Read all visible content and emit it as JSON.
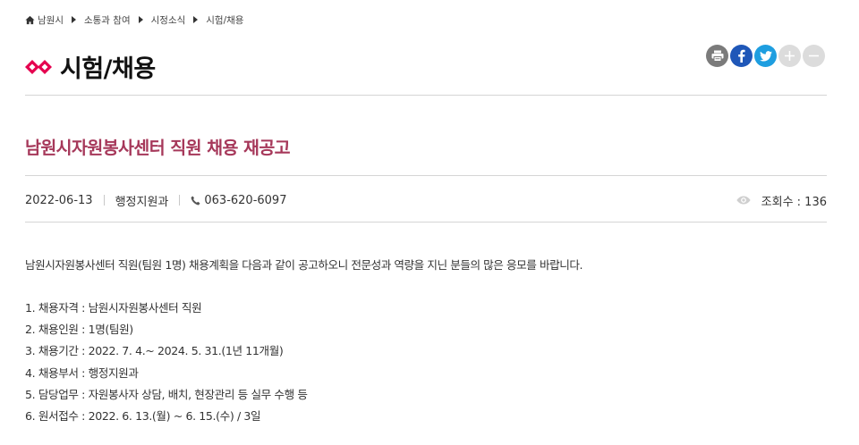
{
  "breadcrumb": [
    "남원시",
    "소통과 참여",
    "시정소식",
    "시험/채용"
  ],
  "page_title": "시험/채용",
  "post": {
    "title": "남원시자원봉사센터 직원 채용 재공고",
    "date": "2022-06-13",
    "department": "행정지원과",
    "phone": "063-620-6097",
    "views": "조회수 : 136",
    "intro": "남원시자원봉사센터 직원(팀원 1명) 채용계획을 다음과 같이 공고하오니 전문성과 역량을 지닌 분들의 많은 응모를 바랍니다.",
    "items": [
      "1. 채용자격 : 남원시자원봉사센터 직원",
      "2. 채용인원 : 1명(팀원)",
      "3. 채용기간 : 2022. 7. 4.~ 2024. 5. 31.(1년 11개월)",
      "4. 채용부서 : 행정지원과",
      "5. 담당업무 : 자원봉사자 상담, 배치, 현장관리 등 실무 수행 등",
      "6. 원서접수 : 2022. 6. 13.(월) ~ 6. 15.(수) / 3일"
    ]
  },
  "share_icons": [
    "print-icon",
    "facebook-icon",
    "twitter-icon",
    "zoom-in-icon",
    "zoom-out-icon"
  ],
  "colors": {
    "accent": "#e5004f",
    "title": "#a6385a",
    "facebook": "#1f57b8",
    "twitter": "#1e9ee0"
  }
}
